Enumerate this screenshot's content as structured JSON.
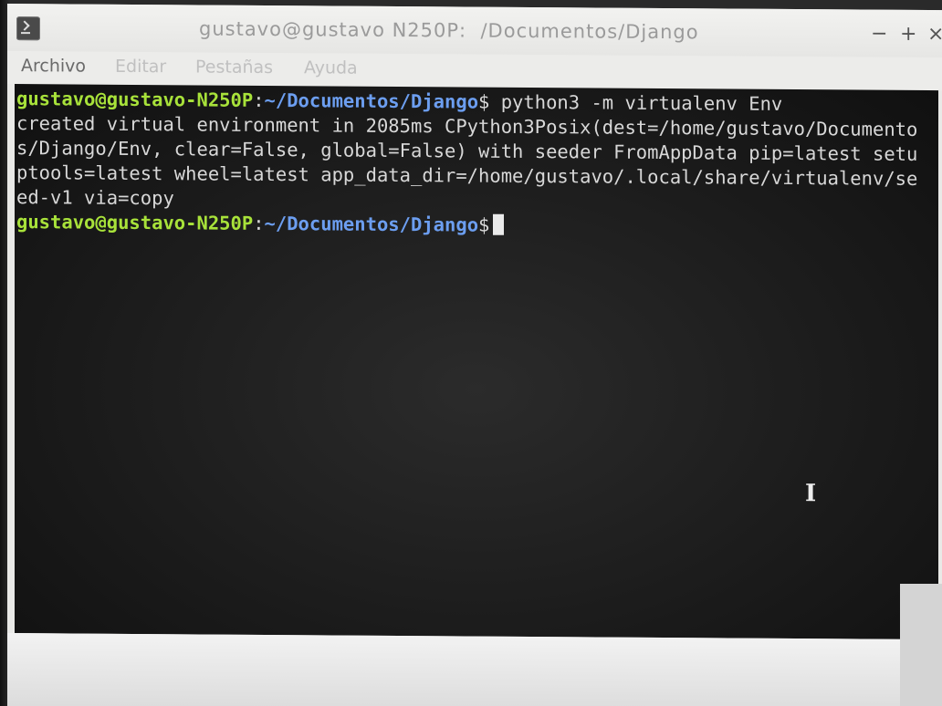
{
  "window": {
    "title": "gustavo@gustavo N250P:  /Documentos/Django",
    "minimize_glyph": "−",
    "maximize_glyph": "+",
    "close_glyph": "×",
    "app_icon": "terminal-icon"
  },
  "menubar": {
    "items": [
      {
        "label": "Archivo"
      },
      {
        "label": "Editar"
      },
      {
        "label": "Pestañas"
      },
      {
        "label": "Ayuda"
      }
    ]
  },
  "terminal": {
    "prompt_user": "gustavo@gustavo-N250P",
    "prompt_sep": ":",
    "prompt_path": "~/Documentos/Django",
    "prompt_dollar": "$",
    "command": " python3 -m virtualenv Env",
    "output_lines": [
      "created virtual environment in 2085ms CPython3Posix(dest=/home/gustavo/Documento",
      "s/Django/Env, clear=False, global=False) with seeder FromAppData pip=latest setu",
      "ptools=latest wheel=latest app_data_dir=/home/gustavo/.local/share/virtualenv/se",
      "ed-v1 via=copy"
    ],
    "colors": {
      "background": "#1c1c1c",
      "text": "#d8d8d8",
      "user": "#a8e23a",
      "path": "#6c9ef0"
    },
    "mouse_cursor": "text-ibeam-cursor"
  }
}
